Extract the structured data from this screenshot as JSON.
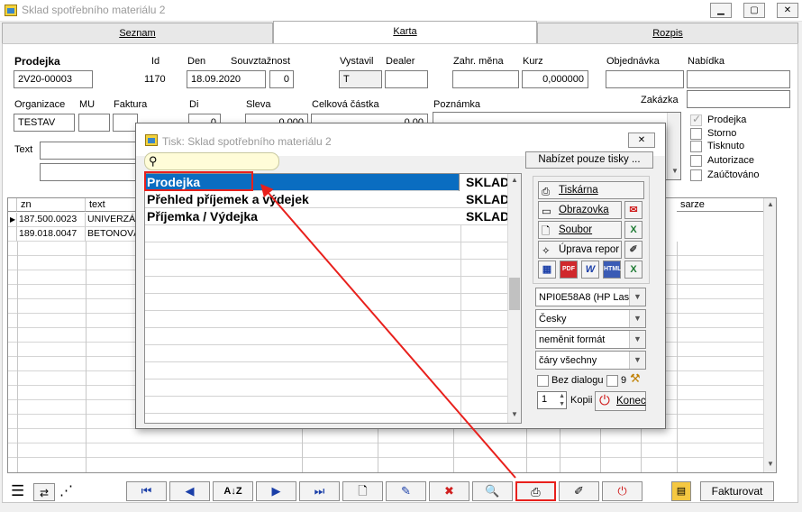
{
  "window": {
    "title": "Sklad spotřebního materiálu 2"
  },
  "tabs": [
    {
      "label": "Seznam"
    },
    {
      "label": "Karta"
    },
    {
      "label": "Rozpis"
    }
  ],
  "form": {
    "prodejka_label": "Prodejka",
    "prodejka_value": "2V20-00003",
    "id_label": "Id",
    "id_value": "1170",
    "den_label": "Den",
    "den_value": "18.09.2020",
    "souvztaznost_label": "Souvztažnost",
    "souvztaznost_value": "0",
    "vystavil_label": "Vystavil",
    "vystavil_value": "T",
    "dealer_label": "Dealer",
    "dealer_value": "",
    "zahr_mena_label": "Zahr. měna",
    "zahr_mena_value": "",
    "kurz_label": "Kurz",
    "kurz_value": "0,000000",
    "objednavka_label": "Objednávka",
    "objednavka_value": "",
    "nabidka_label": "Nabídka",
    "nabidka_value": "",
    "zakazka_label": "Zakázka",
    "zakazka_value": "",
    "organizace_label": "Organizace",
    "organizace_value": "TESTAV",
    "mu_label": "MU",
    "faktura_label": "Faktura",
    "di_label": "Di",
    "di_value": "0",
    "sleva_label": "Sleva",
    "sleva_value": "0,000",
    "celkova_castka_label": "Celková částka",
    "celkova_castka_value": "0,00",
    "poznamka_label": "Poznámka",
    "text_label": "Text"
  },
  "status_checks": [
    {
      "label": "Prodejka",
      "checked": true
    },
    {
      "label": "Storno",
      "checked": false
    },
    {
      "label": "Tisknuto",
      "checked": false
    },
    {
      "label": "Autorizace",
      "checked": false
    },
    {
      "label": "Zaúčtováno",
      "checked": false
    }
  ],
  "grid": {
    "headers": {
      "zn": "zn",
      "text": "text",
      "sarze": "sarze"
    },
    "rows": [
      {
        "zn": "187.500.0023",
        "text": "UNIVERZÁL"
      },
      {
        "zn": "189.018.0047",
        "text": "BETONOVÁ"
      }
    ]
  },
  "bottom": {
    "fakturovat": "Fakturovat"
  },
  "dialog": {
    "title": "Tisk: Sklad spotřebního materiálu 2",
    "search_placeholder": "",
    "offer_prints_button": "Nabízet pouze tisky ...",
    "items": [
      {
        "name": "Prodejka",
        "store": "SKLAD"
      },
      {
        "name": "Přehled příjemek a výdejek",
        "store": "SKLAD"
      },
      {
        "name": "Příjemka / Výdejka",
        "store": "SKLAD"
      }
    ],
    "buttons": {
      "tiskarna": "Tiskárna",
      "obrazovka": "Obrazovka",
      "soubor": "Soubor",
      "uprava": "Úprava repor"
    },
    "export_icons": [
      "calendar-icon",
      "pdf-icon",
      "word-icon",
      "html-icon",
      "excel-icon"
    ],
    "printer": "NPI0E58A8 (HP Lase",
    "language": "Česky",
    "format": "neměnit formát",
    "lines": "čáry všechny",
    "bez_dialogu_label": "Bez dialogu",
    "nine_value": "9",
    "kopii_value": "1",
    "kopii_label": "Kopii",
    "konec": "Konec"
  },
  "colors": {
    "selection": "#0a6dc1",
    "annotation": "#e8201c"
  }
}
